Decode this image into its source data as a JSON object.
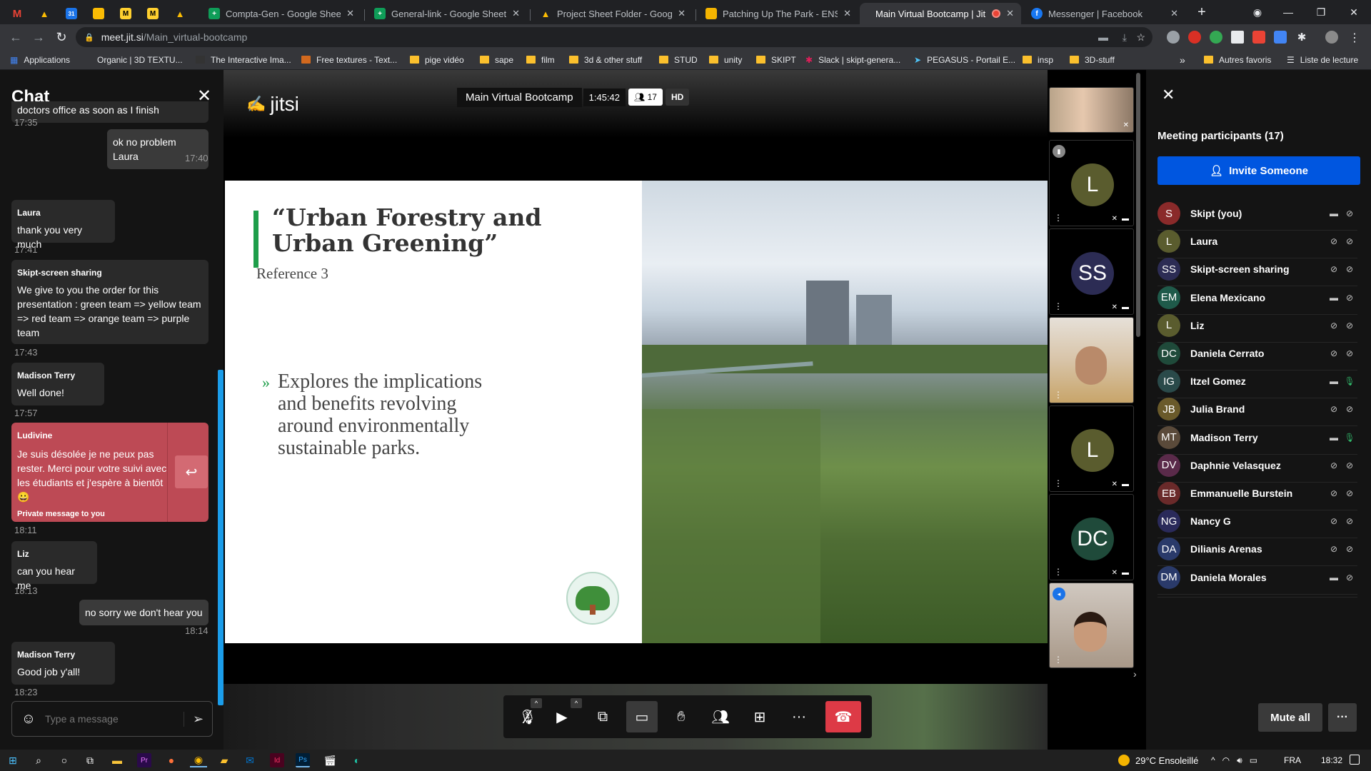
{
  "browser": {
    "tabs": [
      {
        "title": "",
        "icon": "gmail-icon",
        "color": "#ea4335",
        "letter": "M"
      },
      {
        "title": "",
        "icon": "drive-icon",
        "color": "#fbbc04",
        "letter": "▲"
      },
      {
        "title": "",
        "icon": "calendar-icon",
        "color": "#1a73e8",
        "letter": "31"
      },
      {
        "title": "",
        "icon": "keep-icon",
        "color": "#fbbc04",
        "letter": "•"
      },
      {
        "title": "",
        "icon": "miro-icon",
        "color": "#ffd02f",
        "letter": "M"
      },
      {
        "title": "",
        "icon": "miro-icon",
        "color": "#ffd02f",
        "letter": "M"
      },
      {
        "title": "",
        "icon": "drive-icon",
        "color": "#fbbc04",
        "letter": "▲"
      },
      {
        "title": "Compta-Gen - Google Sheets",
        "icon": "sheets-icon",
        "color": "#0f9d58",
        "letter": "+"
      },
      {
        "title": "General-link - Google Sheets",
        "icon": "sheets-icon",
        "color": "#0f9d58",
        "letter": "+"
      },
      {
        "title": "Project Sheet Folder - Google D",
        "icon": "drive-icon",
        "color": "#fbbc04",
        "letter": "▲"
      },
      {
        "title": "Patching Up The Park - ENSAD",
        "icon": "slides-icon",
        "color": "#f4b400",
        "letter": "▭"
      },
      {
        "title": "Main Virtual Bootcamp | Jit",
        "icon": "jitsi-icon",
        "color": "#35363a",
        "letter": ""
      },
      {
        "title": "Messenger | Facebook",
        "icon": "facebook-icon",
        "color": "#1877f2",
        "letter": "f"
      }
    ],
    "url_host": "meet.jit.si",
    "url_path": "/Main_virtual-bootcamp",
    "bookmarks": [
      {
        "label": "Applications",
        "icon": "apps-icon"
      },
      {
        "label": "Organic | 3D TEXTU...",
        "icon": "bookmark-icon"
      },
      {
        "label": "The Interactive Ima...",
        "icon": "bookmark-icon"
      },
      {
        "label": "Free textures - Text...",
        "icon": "bookmark-icon"
      },
      {
        "label": "pige vidéo",
        "icon": "folder-icon"
      },
      {
        "label": "sape",
        "icon": "folder-icon"
      },
      {
        "label": "film",
        "icon": "folder-icon"
      },
      {
        "label": "3d & other stuff",
        "icon": "folder-icon"
      },
      {
        "label": "STUD",
        "icon": "folder-icon"
      },
      {
        "label": "unity",
        "icon": "folder-icon"
      },
      {
        "label": "SKIPT",
        "icon": "folder-icon"
      },
      {
        "label": "Slack | skipt-genera...",
        "icon": "slack-icon"
      },
      {
        "label": "PEGASUS - Portail E...",
        "icon": "bookmark-icon"
      },
      {
        "label": "insp",
        "icon": "folder-icon"
      },
      {
        "label": "3D-stuff",
        "icon": "folder-icon"
      },
      {
        "label": "»",
        "icon": ""
      },
      {
        "label": "Autres favoris",
        "icon": "folder-icon"
      },
      {
        "label": "Liste de lecture",
        "icon": "reading-list-icon"
      }
    ]
  },
  "chat": {
    "title": "Chat",
    "messages": [
      {
        "author": "",
        "text": "doctors office as soon as I finish",
        "time": "17:35",
        "mine": false
      },
      {
        "author": "",
        "text": "ok no problem Laura",
        "time": "17:40",
        "mine": true
      },
      {
        "author": "Laura",
        "text": "thank you very much",
        "time": "17:41",
        "mine": false
      },
      {
        "author": "Skipt-screen sharing",
        "text": "We give to you the order for this presentation : green team => yellow team => red team => orange team => purple team",
        "time": "17:43",
        "mine": false
      },
      {
        "author": "Madison Terry",
        "text": "Well done!",
        "time": "17:57",
        "mine": false
      },
      {
        "author": "Ludivine",
        "text": "Je suis désolée je ne peux pas rester. Merci pour votre suivi avec les étudiants et j'espère à bientôt 😀",
        "time": "18:11",
        "private_note": "Private message to you"
      },
      {
        "author": "Liz",
        "text": "can you hear me",
        "time": "18:13",
        "mine": false
      },
      {
        "author": "",
        "text": "no sorry we don't hear you",
        "time": "18:14",
        "mine": true
      },
      {
        "author": "Madison Terry",
        "text": "Good job y'all!",
        "time": "18:23",
        "mine": false
      }
    ],
    "input_placeholder": "Type a message"
  },
  "meeting": {
    "logo": "jitsi",
    "name": "Main Virtual Bootcamp",
    "duration": "1:45:42",
    "participant_count": "17",
    "quality": "HD"
  },
  "slide": {
    "title": "“Urban Forestry and Urban Greening”",
    "subtitle": "Reference 3",
    "bullet": "Explores the implications and benefits revolving around environmentally sustainable parks."
  },
  "filmstrip": [
    {
      "type": "video",
      "initials": "",
      "color": "#7a6a5a"
    },
    {
      "type": "avatar",
      "initials": "L",
      "color": "#5a5c2e"
    },
    {
      "type": "avatar",
      "initials": "SS",
      "color": "#2c2c54"
    },
    {
      "type": "video",
      "initials": "",
      "color": "#c8b49a"
    },
    {
      "type": "avatar",
      "initials": "L",
      "color": "#5a5c2e"
    },
    {
      "type": "avatar",
      "initials": "DC",
      "color": "#1f4a3a"
    },
    {
      "type": "video",
      "initials": "",
      "color": "#a08a78"
    }
  ],
  "participants": {
    "heading": "Meeting participants (17)",
    "invite_label": "Invite Someone",
    "mute_all_label": "Mute all",
    "list": [
      {
        "initials": "S",
        "name": "Skipt (you)",
        "color": "#8a2a2a",
        "cam": "on",
        "mic": "muted"
      },
      {
        "initials": "L",
        "name": "Laura",
        "color": "#5a5c2e",
        "cam": "off",
        "mic": "muted"
      },
      {
        "initials": "SS",
        "name": "Skipt-screen sharing",
        "color": "#2c2c54",
        "cam": "off",
        "mic": "muted"
      },
      {
        "initials": "EM",
        "name": "Elena Mexicano",
        "color": "#1f5a4a",
        "cam": "on",
        "mic": "muted"
      },
      {
        "initials": "L",
        "name": "Liz",
        "color": "#5a5c2e",
        "cam": "off",
        "mic": "muted"
      },
      {
        "initials": "DC",
        "name": "Daniela Cerrato",
        "color": "#1f4a3a",
        "cam": "off",
        "mic": "muted"
      },
      {
        "initials": "IG",
        "name": "Itzel Gomez",
        "color": "#2a4a4a",
        "cam": "on",
        "mic": "active"
      },
      {
        "initials": "JB",
        "name": "Julia Brand",
        "color": "#6a5a2a",
        "cam": "off",
        "mic": "muted"
      },
      {
        "initials": "MT",
        "name": "Madison Terry",
        "color": "#5a4a3a",
        "cam": "on",
        "mic": "active"
      },
      {
        "initials": "DV",
        "name": "Daphnie Velasquez",
        "color": "#5a2a4a",
        "cam": "off",
        "mic": "muted"
      },
      {
        "initials": "EB",
        "name": "Emmanuelle Burstein",
        "color": "#6a2a2a",
        "cam": "off",
        "mic": "muted"
      },
      {
        "initials": "NG",
        "name": "Nancy G",
        "color": "#2a2a5a",
        "cam": "off",
        "mic": "muted"
      },
      {
        "initials": "DA",
        "name": "Dilianis Arenas",
        "color": "#2a3a6a",
        "cam": "off",
        "mic": "muted"
      },
      {
        "initials": "DM",
        "name": "Daniela Morales",
        "color": "#2a3a6a",
        "cam": "on",
        "mic": "muted"
      }
    ]
  },
  "taskbar": {
    "weather": "29°C Ensoleillé",
    "lang": "FRA",
    "time": "18:32"
  },
  "colors": {
    "accent": "#0056e0",
    "hangup": "#dd3a46",
    "private": "#bd4a55",
    "slide_bar": "#1e9e4a"
  }
}
